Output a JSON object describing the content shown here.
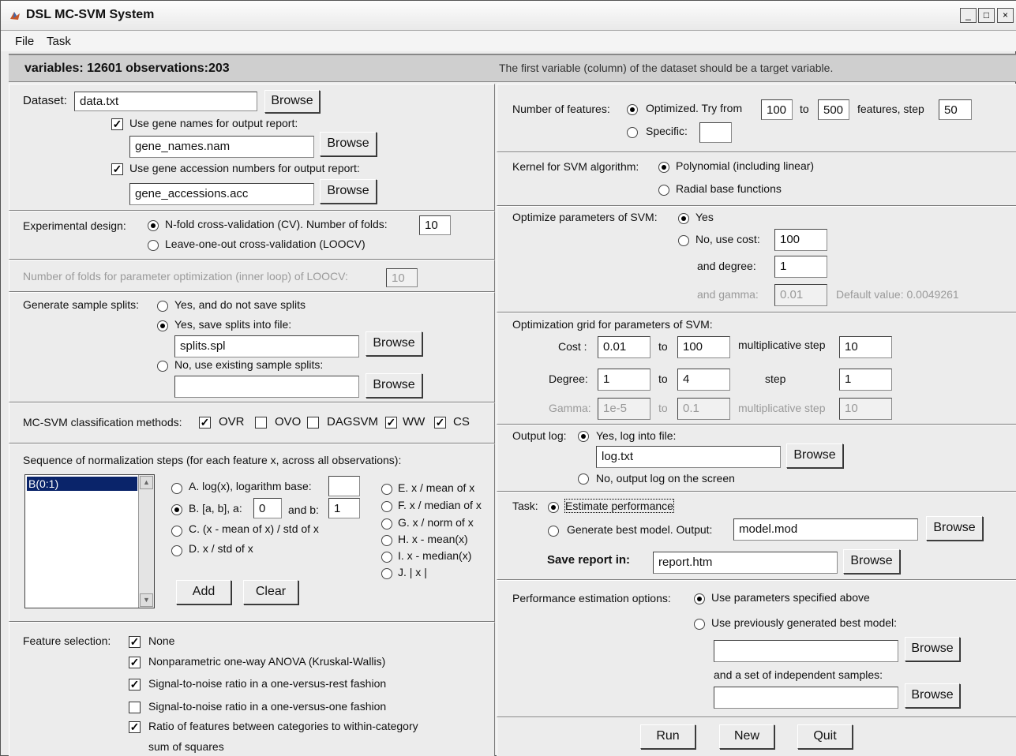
{
  "window": {
    "title": "DSL MC-SVM System",
    "controls": [
      "_",
      "□",
      "×"
    ]
  },
  "menu": [
    "File",
    "Task"
  ],
  "info": {
    "variables_text": "variables: 12601  observations:203",
    "note": "The first variable (column) of the dataset should be a target variable."
  },
  "dataset": {
    "label": "Dataset:",
    "value": "data.txt",
    "browse": "Browse",
    "gene_names_label": "Use gene names for output report:",
    "gene_names_checked": true,
    "gene_names_value": "gene_names.nam",
    "gene_acc_label": "Use gene accession numbers for output report:",
    "gene_acc_checked": true,
    "gene_acc_value": "gene_accessions.acc"
  },
  "design": {
    "label": "Experimental design:",
    "opt1": "N-fold cross-validation (CV). Number of folds:",
    "folds": "10",
    "opt2": "Leave-one-out cross-validation (LOOCV)",
    "inner_label": "Number of folds for parameter optimization (inner loop) of LOOCV:",
    "inner_value": "10"
  },
  "splits": {
    "label": "Generate sample splits:",
    "opt1": "Yes, and do not save splits",
    "opt2": "Yes, save splits into file:",
    "file": "splits.spl",
    "opt3": "No, use existing sample splits:",
    "existing": ""
  },
  "methods": {
    "label": "MC-SVM classification methods:",
    "items": [
      {
        "name": "OVR",
        "checked": true
      },
      {
        "name": "OVO",
        "checked": false
      },
      {
        "name": "DAGSVM",
        "checked": false
      },
      {
        "name": "WW",
        "checked": true
      },
      {
        "name": "CS",
        "checked": true
      }
    ]
  },
  "normalization": {
    "label": "Sequence of normalization steps (for each feature x, across all observations):",
    "list": [
      "B(0:1)"
    ],
    "A": "A. log(x), logarithm base:",
    "A_value": "",
    "B": "B. [a, b], a:",
    "a_value": "0",
    "and_b": "and b:",
    "b_value": "1",
    "C": "C. (x - mean of x) / std of x",
    "D": "D. x  / std of x",
    "E": "E. x / mean of x",
    "F": "F. x / median of x",
    "G": "G. x  / norm of x",
    "H": "H. x - mean(x)",
    "I": "I. x - median(x)",
    "J": "J. | x |",
    "add": "Add",
    "clear": "Clear"
  },
  "feature_selection": {
    "label": "Feature selection:",
    "items": [
      {
        "text": "None",
        "checked": true
      },
      {
        "text": "Nonparametric one-way ANOVA (Kruskal-Wallis)",
        "checked": true
      },
      {
        "text": "Signal-to-noise ratio in a one-versus-rest fashion",
        "checked": true
      },
      {
        "text": "Signal-to-noise ratio in a one-versus-one fashion",
        "checked": false
      },
      {
        "text": "Ratio of features between categories to within-category",
        "checked": true
      }
    ],
    "item5_line2": "sum of squares"
  },
  "num_features": {
    "label": "Number of features:",
    "opt1": "Optimized. Try from",
    "from": "100",
    "to_label": "to",
    "to": "500",
    "features_step": "features, step",
    "step": "50",
    "opt2": "Specific:",
    "specific": ""
  },
  "kernel": {
    "label": "Kernel for SVM algorithm:",
    "opt1": "Polynomial (including linear)",
    "opt2": "Radial base functions"
  },
  "optimize": {
    "label": "Optimize parameters of SVM:",
    "yes": "Yes",
    "no": "No, use cost:",
    "cost": "100",
    "degree_label": "and degree:",
    "degree": "1",
    "gamma_label": "and gamma:",
    "gamma": "0.01",
    "default_text": "Default value: 0.0049261"
  },
  "grid": {
    "label": "Optimization grid for parameters of SVM:",
    "cost_label": "Cost :",
    "cost_from": "0.01",
    "cost_to": "100",
    "mult_step": "multiplicative step",
    "cost_step": "10",
    "degree_label": "Degree:",
    "degree_from": "1",
    "degree_to": "4",
    "step_label": "step",
    "degree_step": "1",
    "gamma_label": "Gamma:",
    "gamma_from": "1e-5",
    "gamma_to": "0.1",
    "gamma_step": "10",
    "to": "to"
  },
  "output_log": {
    "label": "Output log:",
    "opt1": "Yes, log into file:",
    "file": "log.txt",
    "opt2": "No, output log on the screen"
  },
  "task": {
    "label": "Task:",
    "opt1": "Estimate performance",
    "opt2": "Generate best model. Output:",
    "model_file": "model.mod",
    "save_label": "Save report in:",
    "report": "report.htm"
  },
  "perf": {
    "label": "Performance estimation options:",
    "opt1": "Use parameters specified above",
    "opt2": "Use previously generated best model:",
    "model_path": "",
    "indep_label": "and a set of independent samples:",
    "indep_path": ""
  },
  "actions": {
    "run": "Run",
    "new": "New",
    "quit": "Quit"
  }
}
